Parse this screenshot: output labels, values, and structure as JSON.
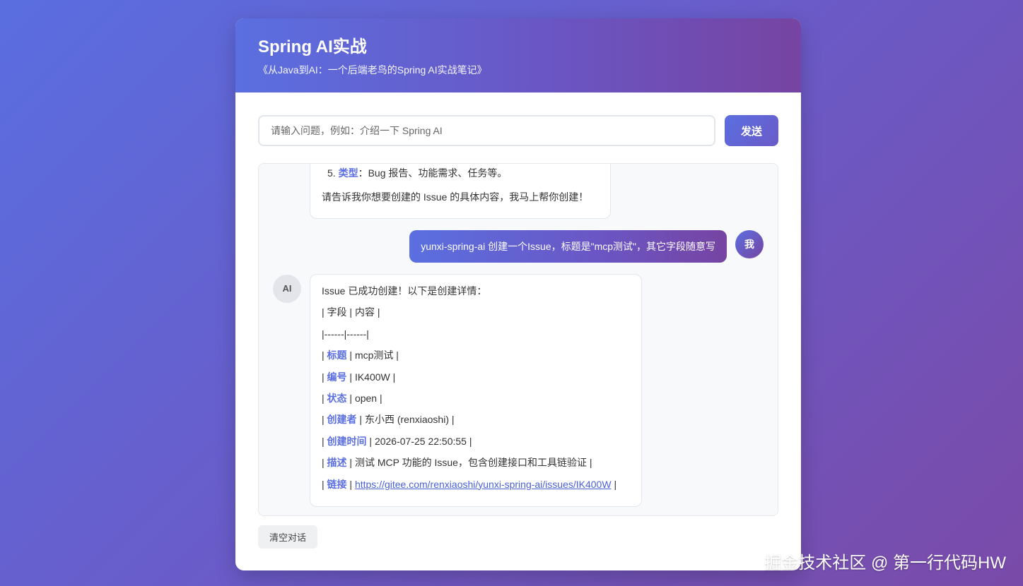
{
  "header": {
    "title": "Spring AI实战",
    "subtitle": "《从Java到AI：一个后端老鸟的Spring AI实战笔记》"
  },
  "input": {
    "placeholder": "请输入问题，例如：介绍一下 Spring AI",
    "value": ""
  },
  "send_label": "发送",
  "previous_ai_message": {
    "list_item_number": "5.",
    "list_item_keyword": "类型",
    "list_item_text": "：Bug 报告、功能需求、任务等。",
    "closing": "请告诉我你想要创建的 Issue 的具体内容，我马上帮你创建！"
  },
  "user_message": {
    "text": "yunxi-spring-ai 创建一个Issue，标题是\"mcp测试\"，其它字段随意写",
    "avatar": "我"
  },
  "ai_message": {
    "avatar": "AI",
    "intro": "Issue 已成功创建！以下是创建详情：",
    "table_header": "| 字段 | 内容 |",
    "table_separator": "|------|------|",
    "rows": [
      {
        "key": "标题",
        "value": "mcp测试"
      },
      {
        "key": "编号",
        "value": "IK400W"
      },
      {
        "key": "状态",
        "value": "open"
      },
      {
        "key": "创建者",
        "value": "东小西 (renxiaoshi)"
      },
      {
        "key": "创建时间",
        "value": "2026-07-25 22:50:55"
      },
      {
        "key": "描述",
        "value": "测试 MCP 功能的 Issue，包含创建接口和工具链验证"
      }
    ],
    "link_row": {
      "key": "链接",
      "url": "https://gitee.com/renxiaoshi/yunxi-spring-ai/issues/IK400W"
    }
  },
  "clear_label": "清空对话",
  "watermark": "掘金技术社区 @ 第一行代码HW",
  "colors": {
    "accent": "#5b6fe0",
    "accent_end": "#7644a2",
    "link": "#4a60d6"
  }
}
